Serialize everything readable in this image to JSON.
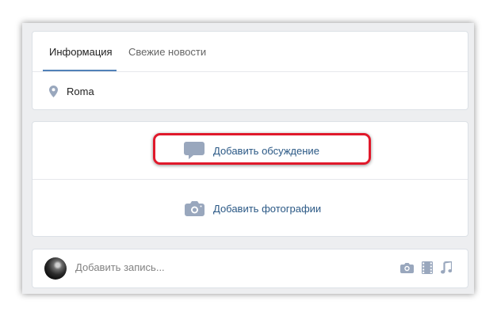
{
  "tabs": [
    {
      "label": "Информация",
      "active": true
    },
    {
      "label": "Свежие новости",
      "active": false
    }
  ],
  "location": {
    "icon": "map-pin-icon",
    "text": "Roma"
  },
  "actions": [
    {
      "icon": "discussion-icon",
      "label": "Добавить обсуждение",
      "highlighted": true
    },
    {
      "icon": "camera-icon",
      "label": "Добавить фотографии",
      "highlighted": false
    }
  ],
  "post": {
    "placeholder": "Добавить запись...",
    "attach_icons": [
      "camera-icon",
      "film-icon",
      "music-note-icon"
    ]
  },
  "colors": {
    "accent": "#5181b8",
    "link": "#2a5885",
    "icon": "#99a7bd",
    "highlight": "#e0192b",
    "background": "#edeef0"
  }
}
